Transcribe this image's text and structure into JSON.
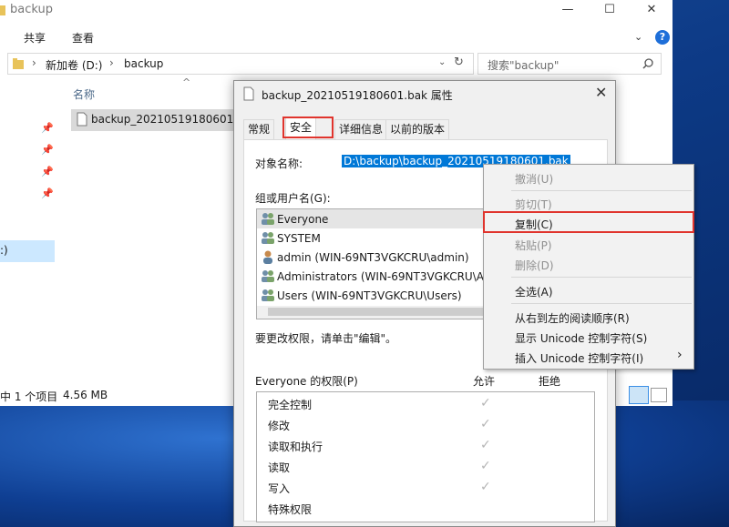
{
  "explorer": {
    "title": "backup",
    "ribbon": [
      "共享",
      "查看"
    ],
    "address": {
      "drive": "新加卷 (D:)",
      "folder": "backup"
    },
    "search_placeholder": "搜索\"backup\"",
    "column_name": "名称",
    "file_name": "backup_20210519180601.bak",
    "nav_fragment": ":)",
    "status": {
      "items": "中 1 个项目",
      "size": "4.56 MB"
    }
  },
  "dialog": {
    "title": "backup_20210519180601.bak 属性",
    "tabs": [
      "常规",
      "安全",
      "详细信息",
      "以前的版本"
    ],
    "object_label": "对象名称:",
    "object_value": "D:\\backup\\backup_20210519180601.bak",
    "groups_label": "组或用户名(G):",
    "groups": [
      {
        "name": "Everyone",
        "type": "group"
      },
      {
        "name": "SYSTEM",
        "type": "group"
      },
      {
        "name": "admin (WIN-69NT3VGKCRU\\admin)",
        "type": "user"
      },
      {
        "name": "Administrators (WIN-69NT3VGKCRU\\A",
        "type": "group"
      },
      {
        "name": "Users (WIN-69NT3VGKCRU\\Users)",
        "type": "group"
      }
    ],
    "edit_hint": "要更改权限，请单击\"编辑\"。",
    "perm_label": "Everyone 的权限(P)",
    "perm_allow": "允许",
    "perm_deny": "拒绝",
    "permissions": [
      "完全控制",
      "修改",
      "读取和执行",
      "读取",
      "写入",
      "特殊权限"
    ],
    "perm_allow_checked": [
      true,
      true,
      true,
      true,
      true,
      false
    ]
  },
  "context_menu": {
    "items": [
      {
        "label": "撤消(U)",
        "enabled": false
      },
      {
        "label": "剪切(T)",
        "enabled": false
      },
      {
        "label": "复制(C)",
        "enabled": true
      },
      {
        "label": "粘贴(P)",
        "enabled": false
      },
      {
        "label": "删除(D)",
        "enabled": false
      },
      {
        "label": "全选(A)",
        "enabled": true
      },
      {
        "label": "从右到左的阅读顺序(R)",
        "enabled": true
      },
      {
        "label": "显示 Unicode 控制字符(S)",
        "enabled": true
      },
      {
        "label": "插入 Unicode 控制字符(I)",
        "enabled": true
      }
    ],
    "submenu_arrow": "›"
  },
  "colors": {
    "selection_blue": "#0078d7",
    "highlight_red": "#e0342d",
    "help_blue": "#1e6fd9"
  }
}
